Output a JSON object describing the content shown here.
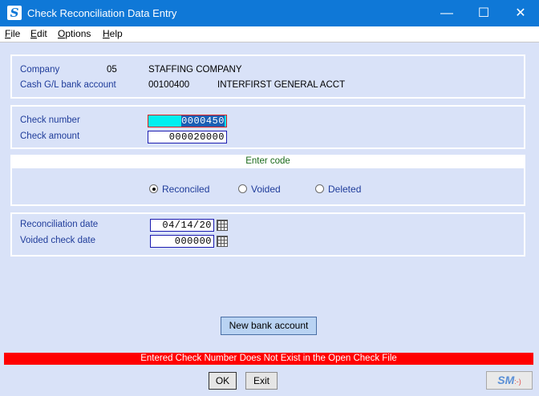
{
  "window": {
    "title": "Check Reconciliation Data Entry",
    "app_icon_letter": "S",
    "minimize_glyph": "—",
    "maximize_glyph": "☐",
    "close_glyph": "✕"
  },
  "menu": [
    {
      "accel": "F",
      "rest": "ile"
    },
    {
      "accel": "E",
      "rest": "dit"
    },
    {
      "accel": "O",
      "rest": "ptions"
    },
    {
      "accel": "H",
      "rest": "elp"
    }
  ],
  "company_panel": {
    "company_label": "Company",
    "company_code": "05",
    "company_name": "STAFFING COMPANY",
    "bank_label": "Cash G/L bank account",
    "bank_code": "00100400",
    "bank_name": "INTERFIRST GENERAL ACCT"
  },
  "check_panel": {
    "check_number_label": "Check number",
    "check_number_value": "0000450",
    "check_amount_label": "Check amount",
    "check_amount_value": "000020000"
  },
  "code_panel": {
    "header": "Enter code",
    "options": [
      {
        "label": "Reconciled",
        "checked": true
      },
      {
        "label": "Voided",
        "checked": false
      },
      {
        "label": "Deleted",
        "checked": false
      }
    ]
  },
  "date_panel": {
    "reconciliation_label": "Reconciliation date",
    "reconciliation_value": "04/14/20",
    "voided_label": "Voided check date",
    "voided_value": "000000"
  },
  "buttons": {
    "new_bank": "New bank account",
    "ok": "OK",
    "exit": "Exit"
  },
  "status_message": "Entered Check Number Does Not Exist in the Open Check File",
  "logo": {
    "text": "SM",
    "smile": ":-)"
  },
  "colors": {
    "titlebar": "#0f78d7",
    "background": "#d9e2f8",
    "label_blue": "#1f3c9a",
    "status_red": "#ff0000"
  }
}
